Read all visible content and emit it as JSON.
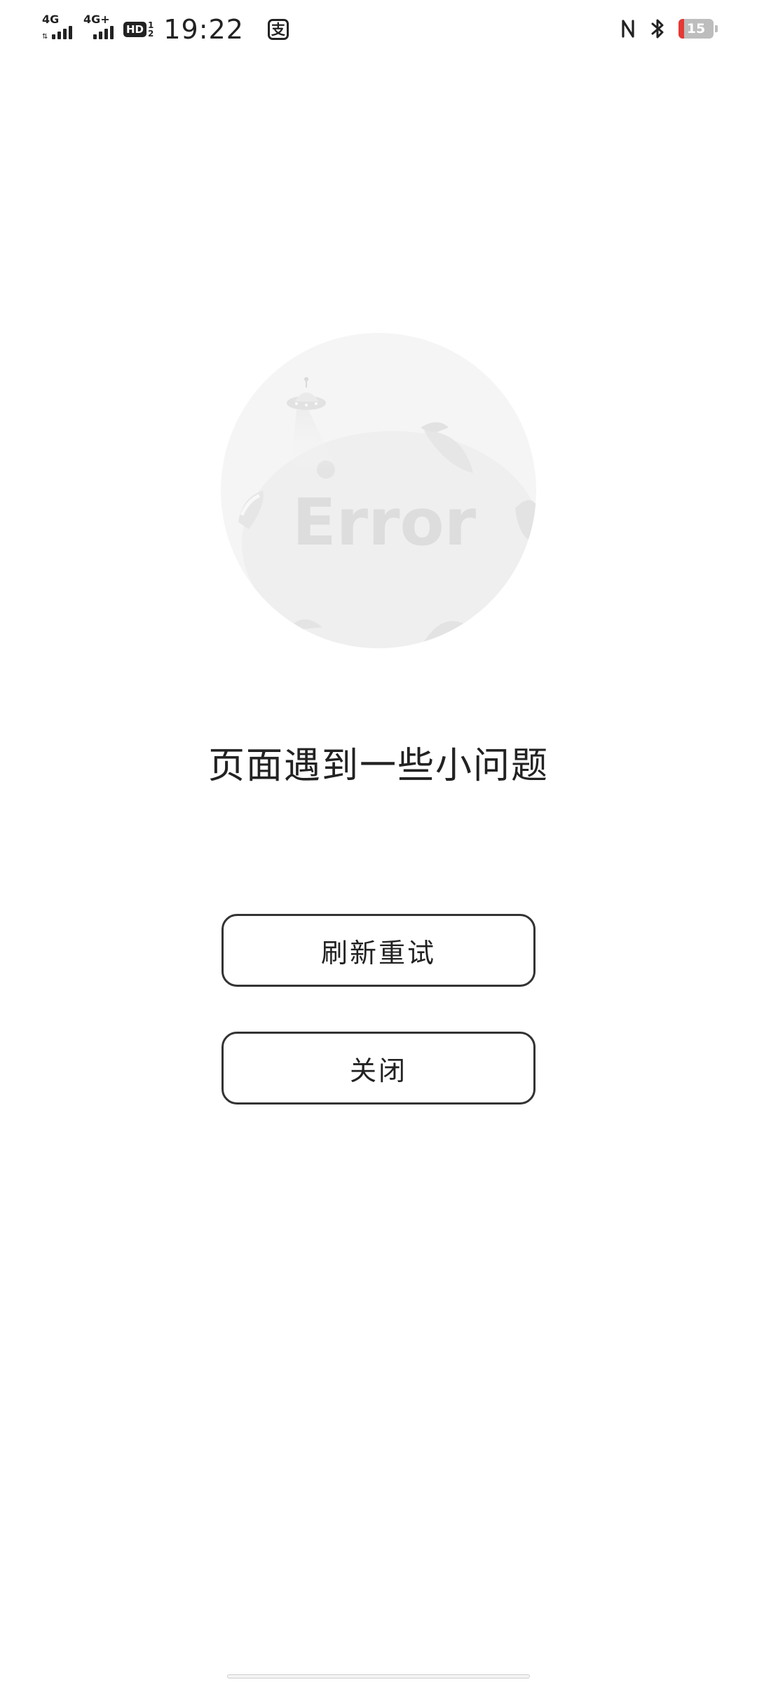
{
  "status_bar": {
    "sim1_network": "4G",
    "sim2_network": "4G+",
    "hd_label": "HD",
    "hd_slot_top": "1",
    "hd_slot_bottom": "2",
    "time": "19:22",
    "app_notification_icon": "alipay-icon",
    "app_notification_glyph": "支",
    "nfc_icon": "nfc-icon",
    "bluetooth_icon": "bluetooth-icon",
    "battery_level": "15",
    "battery_fraction": 0.15,
    "battery_color": "#e53935"
  },
  "illustration": {
    "text": "Error",
    "icon": "error-planet-illustration"
  },
  "main": {
    "message": "页面遇到一些小问题",
    "refresh_button": "刷新重试",
    "close_button": "关闭"
  },
  "colors": {
    "background": "#ffffff",
    "text": "#222222",
    "button_border": "#333333",
    "illustration_fill": "#f5f5f5"
  }
}
